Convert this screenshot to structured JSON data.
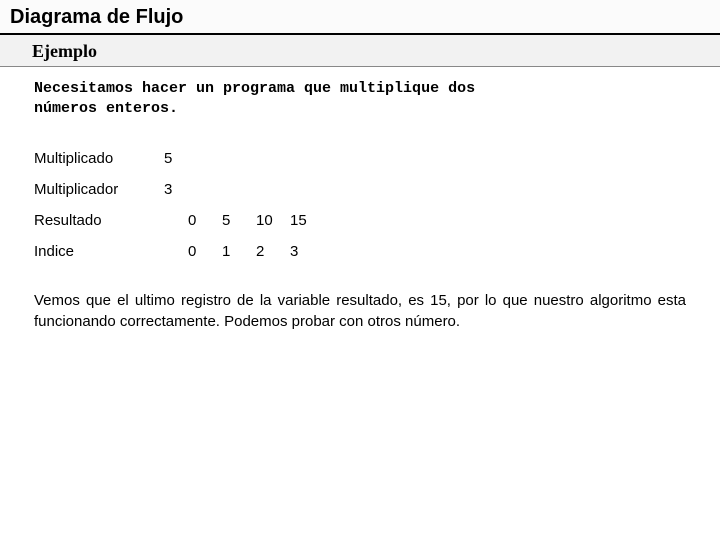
{
  "header": {
    "title": "Diagrama de Flujo",
    "subtitle": "Ejemplo"
  },
  "statement": {
    "line1": "Necesitamos hacer un programa que multiplique dos",
    "line2": "números enteros."
  },
  "variables": {
    "multiplicado": {
      "label": "Multiplicado",
      "value": "5"
    },
    "multiplicador": {
      "label": "Multiplicador",
      "value": "3"
    },
    "resultado": {
      "label": "Resultado",
      "values": [
        "0",
        "5",
        "10",
        "15"
      ]
    },
    "indice": {
      "label": "Indice",
      "values": [
        "0",
        "1",
        "2",
        "3"
      ]
    }
  },
  "closing": "Vemos que el ultimo registro de la variable resultado, es 15, por lo que nuestro algoritmo esta funcionando correctamente. Podemos probar con otros número."
}
